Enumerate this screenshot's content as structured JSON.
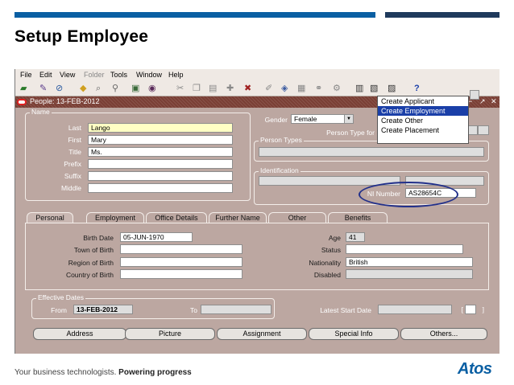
{
  "slide": {
    "title": "Setup Employee",
    "footer": "Your business technologists.",
    "footer_bold": "Powering progress",
    "logo": "Atos"
  },
  "menu": [
    "File",
    "Edit",
    "View",
    "Folder",
    "Tools",
    "Window",
    "Help"
  ],
  "window": {
    "title": "People: 13-FEB-2012"
  },
  "dropdown": {
    "items": [
      "Create Applicant",
      "Create Employment",
      "Create Other",
      "Create Placement"
    ],
    "selected_index": 1
  },
  "name_frame": {
    "title": "Name",
    "labels": {
      "last": "Last",
      "first": "First",
      "title": "Title",
      "prefix": "Prefix",
      "suffix": "Suffix",
      "middle": "Middle"
    },
    "values": {
      "last": "Lango",
      "first": "Mary",
      "title": "Ms.",
      "prefix": "",
      "suffix": "",
      "middle": ""
    }
  },
  "gender": {
    "label": "Gender",
    "value": "Female"
  },
  "person_type_for": {
    "label": "Person Type for"
  },
  "person_types": {
    "title": "Person Types"
  },
  "identification": {
    "title": "Identification",
    "ni_label": "NI Number",
    "ni_value": "AS28654C"
  },
  "tabs": [
    "Personal",
    "Employment",
    "Office Details",
    "Further Name",
    "Other",
    "Benefits"
  ],
  "personal": {
    "birth_date_label": "Birth Date",
    "birth_date": "05-JUN-1970",
    "town_label": "Town of Birth",
    "town": "",
    "region_label": "Region of Birth",
    "region": "",
    "country_label": "Country of Birth",
    "country": "",
    "age_label": "Age",
    "age": "41",
    "status_label": "Status",
    "status": "",
    "nationality_label": "Nationality",
    "nationality": "British",
    "disabled_label": "Disabled",
    "disabled": ""
  },
  "effective_dates": {
    "title": "Effective Dates",
    "from_label": "From",
    "from": "13-FEB-2012",
    "to_label": "To",
    "to": "",
    "latest_start_label": "Latest Start Date",
    "latest_start": "",
    "bracket": "[",
    "checkbox_bracket": "]"
  },
  "buttons": [
    "Address",
    "Picture",
    "Assignment",
    "Special Info",
    "Others..."
  ],
  "colors": {
    "form_bg": "#bca7a1",
    "title_bar": "#7a3f35",
    "selection": "#1a3fa8",
    "highlight_ellipse": "#22308a",
    "brand_blue": "#0a5fa3"
  }
}
